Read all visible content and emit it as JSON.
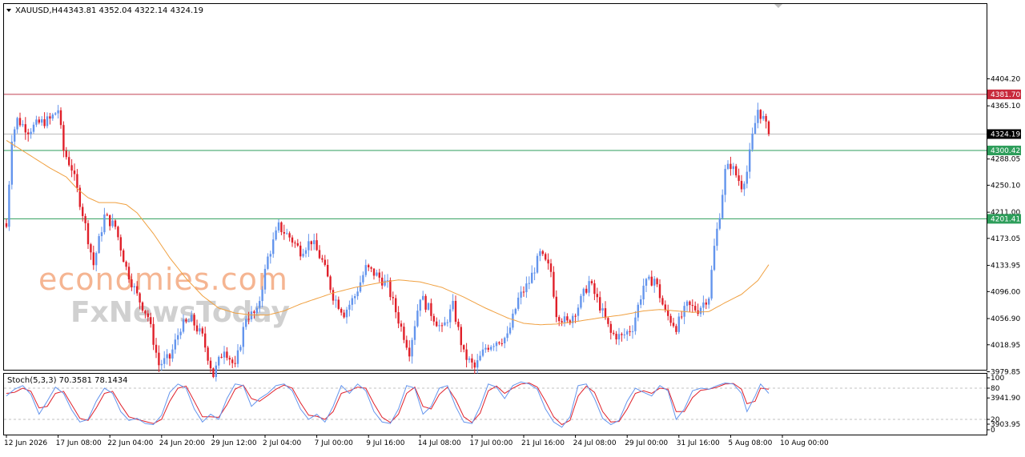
{
  "header": {
    "symbol": "XAUUSD,H4",
    "ohlc": "4343.81 4352.04 4322.14 4324.19"
  },
  "watermark": {
    "line1": "economies.com",
    "line2": "FxNewsToday"
  },
  "colors": {
    "bull": "#6495ed",
    "bear": "#e0202a",
    "ma": "#f0a040",
    "stoch_main": "#6495ed",
    "stoch_signal": "#e0202a",
    "resistance": "#c04050",
    "support": "#2e9e5b",
    "current": "#000000"
  },
  "chart_data": [
    {
      "type": "candlestick",
      "symbol": "XAUUSD",
      "timeframe": "H4",
      "ylim": [
        3890,
        4420
      ],
      "y_ticks": [
        4404.2,
        4365.1,
        4326.0,
        4288.05,
        4250.1,
        4211.0,
        4173.05,
        4133.95,
        4096.0,
        4056.9,
        4018.95,
        3979.85,
        3941.9,
        3903.95
      ],
      "x_tick_labels": [
        "12 Jun 2026",
        "17 Jun 08:00",
        "22 Jun 04:00",
        "24 Jun 20:00",
        "29 Jun 12:00",
        "2 Jul 04:00",
        "7 Jul 00:00",
        "9 Jul 16:00",
        "14 Jul 08:00",
        "17 Jul 00:00",
        "21 Jul 16:00",
        "24 Jul 08:00",
        "29 Jul 00:00",
        "31 Jul 16:00",
        "5 Aug 08:00",
        "10 Aug 00:00"
      ],
      "x_tick_index": [
        0,
        19,
        38,
        57,
        76,
        95,
        114,
        133,
        152,
        171,
        190,
        209,
        228,
        247,
        266,
        285
      ],
      "price_lines": [
        {
          "name": "resistance",
          "value": 4381.7,
          "label": "4381.70"
        },
        {
          "name": "current",
          "value": 4324.19,
          "label": "4324.19"
        },
        {
          "name": "support-1",
          "value": 4300.42,
          "label": "4300.42"
        },
        {
          "name": "support-2",
          "value": 4201.41,
          "label": "4201.41"
        }
      ],
      "anchors": [
        [
          0,
          4190
        ],
        [
          2,
          4320
        ],
        [
          4,
          4345
        ],
        [
          8,
          4330
        ],
        [
          12,
          4340
        ],
        [
          16,
          4345
        ],
        [
          19,
          4360
        ],
        [
          21,
          4300
        ],
        [
          24,
          4275
        ],
        [
          28,
          4210
        ],
        [
          32,
          4135
        ],
        [
          36,
          4205
        ],
        [
          40,
          4190
        ],
        [
          44,
          4130
        ],
        [
          48,
          4090
        ],
        [
          52,
          4060
        ],
        [
          56,
          3990
        ],
        [
          60,
          4000
        ],
        [
          64,
          4045
        ],
        [
          68,
          4055
        ],
        [
          72,
          4030
        ],
        [
          76,
          3975
        ],
        [
          80,
          4015
        ],
        [
          84,
          3985
        ],
        [
          88,
          4060
        ],
        [
          92,
          4065
        ],
        [
          96,
          4145
        ],
        [
          100,
          4190
        ],
        [
          104,
          4175
        ],
        [
          108,
          4155
        ],
        [
          112,
          4170
        ],
        [
          116,
          4140
        ],
        [
          120,
          4090
        ],
        [
          124,
          4065
        ],
        [
          128,
          4090
        ],
        [
          132,
          4130
        ],
        [
          136,
          4120
        ],
        [
          140,
          4105
        ],
        [
          144,
          4055
        ],
        [
          148,
          4010
        ],
        [
          152,
          4090
        ],
        [
          156,
          4065
        ],
        [
          160,
          4040
        ],
        [
          164,
          4075
        ],
        [
          168,
          4005
        ],
        [
          172,
          3985
        ],
        [
          176,
          4015
        ],
        [
          180,
          4025
        ],
        [
          184,
          4030
        ],
        [
          188,
          4085
        ],
        [
          192,
          4110
        ],
        [
          196,
          4150
        ],
        [
          200,
          4125
        ],
        [
          202,
          4065
        ],
        [
          206,
          4050
        ],
        [
          210,
          4075
        ],
        [
          214,
          4110
        ],
        [
          218,
          4075
        ],
        [
          222,
          4035
        ],
        [
          226,
          4030
        ],
        [
          230,
          4045
        ],
        [
          234,
          4105
        ],
        [
          238,
          4115
        ],
        [
          242,
          4065
        ],
        [
          246,
          4045
        ],
        [
          250,
          4075
        ],
        [
          254,
          4070
        ],
        [
          258,
          4090
        ],
        [
          260,
          4160
        ],
        [
          262,
          4210
        ],
        [
          264,
          4270
        ],
        [
          266,
          4280
        ],
        [
          270,
          4250
        ],
        [
          272,
          4270
        ],
        [
          274,
          4320
        ],
        [
          276,
          4360
        ],
        [
          278,
          4346
        ],
        [
          280,
          4324
        ]
      ],
      "last_close": 4324.19,
      "moving_average": {
        "anchors": [
          [
            0,
            4315
          ],
          [
            8,
            4295
          ],
          [
            16,
            4275
          ],
          [
            22,
            4262
          ],
          [
            26,
            4245
          ],
          [
            30,
            4232
          ],
          [
            34,
            4225
          ],
          [
            40,
            4225
          ],
          [
            44,
            4222
          ],
          [
            48,
            4210
          ],
          [
            54,
            4180
          ],
          [
            60,
            4145
          ],
          [
            66,
            4115
          ],
          [
            72,
            4090
          ],
          [
            78,
            4072
          ],
          [
            84,
            4065
          ],
          [
            90,
            4062
          ],
          [
            96,
            4062
          ],
          [
            102,
            4068
          ],
          [
            108,
            4078
          ],
          [
            114,
            4086
          ],
          [
            120,
            4094
          ],
          [
            128,
            4102
          ],
          [
            136,
            4108
          ],
          [
            144,
            4113
          ],
          [
            152,
            4110
          ],
          [
            160,
            4102
          ],
          [
            168,
            4088
          ],
          [
            176,
            4072
          ],
          [
            184,
            4058
          ],
          [
            190,
            4050
          ],
          [
            196,
            4048
          ],
          [
            202,
            4049
          ],
          [
            210,
            4053
          ],
          [
            218,
            4058
          ],
          [
            226,
            4062
          ],
          [
            234,
            4068
          ],
          [
            240,
            4070
          ],
          [
            246,
            4068
          ],
          [
            252,
            4066
          ],
          [
            258,
            4067
          ],
          [
            264,
            4080
          ],
          [
            270,
            4092
          ],
          [
            276,
            4112
          ],
          [
            280,
            4135
          ]
        ]
      }
    },
    {
      "type": "line",
      "name": "Stoch(5,3,3)",
      "label": "Stoch(5,3,3) 70.3581 78.1434",
      "ylim": [
        0,
        100
      ],
      "levels": [
        20,
        80
      ],
      "y_ticks": [
        100,
        80,
        20,
        0
      ],
      "main_anchors": [
        [
          0,
          65
        ],
        [
          3,
          78
        ],
        [
          6,
          85
        ],
        [
          9,
          68
        ],
        [
          12,
          30
        ],
        [
          15,
          55
        ],
        [
          18,
          82
        ],
        [
          21,
          70
        ],
        [
          24,
          38
        ],
        [
          27,
          15
        ],
        [
          30,
          20
        ],
        [
          33,
          55
        ],
        [
          36,
          80
        ],
        [
          39,
          70
        ],
        [
          42,
          35
        ],
        [
          45,
          18
        ],
        [
          48,
          22
        ],
        [
          51,
          12
        ],
        [
          54,
          10
        ],
        [
          57,
          28
        ],
        [
          60,
          72
        ],
        [
          63,
          88
        ],
        [
          66,
          80
        ],
        [
          69,
          40
        ],
        [
          72,
          15
        ],
        [
          75,
          30
        ],
        [
          78,
          20
        ],
        [
          81,
          60
        ],
        [
          84,
          88
        ],
        [
          87,
          85
        ],
        [
          90,
          45
        ],
        [
          93,
          60
        ],
        [
          96,
          70
        ],
        [
          99,
          85
        ],
        [
          102,
          88
        ],
        [
          105,
          75
        ],
        [
          108,
          40
        ],
        [
          111,
          20
        ],
        [
          114,
          30
        ],
        [
          117,
          15
        ],
        [
          120,
          45
        ],
        [
          123,
          85
        ],
        [
          126,
          70
        ],
        [
          129,
          88
        ],
        [
          132,
          75
        ],
        [
          135,
          35
        ],
        [
          138,
          15
        ],
        [
          141,
          12
        ],
        [
          144,
          40
        ],
        [
          147,
          85
        ],
        [
          150,
          80
        ],
        [
          153,
          30
        ],
        [
          156,
          45
        ],
        [
          159,
          80
        ],
        [
          162,
          85
        ],
        [
          165,
          45
        ],
        [
          168,
          15
        ],
        [
          171,
          12
        ],
        [
          174,
          45
        ],
        [
          177,
          88
        ],
        [
          180,
          82
        ],
        [
          183,
          60
        ],
        [
          186,
          85
        ],
        [
          189,
          92
        ],
        [
          192,
          88
        ],
        [
          195,
          78
        ],
        [
          198,
          40
        ],
        [
          201,
          15
        ],
        [
          204,
          5
        ],
        [
          207,
          25
        ],
        [
          210,
          85
        ],
        [
          213,
          88
        ],
        [
          216,
          60
        ],
        [
          219,
          22
        ],
        [
          222,
          10
        ],
        [
          225,
          18
        ],
        [
          228,
          55
        ],
        [
          231,
          80
        ],
        [
          234,
          72
        ],
        [
          237,
          65
        ],
        [
          240,
          85
        ],
        [
          243,
          75
        ],
        [
          246,
          20
        ],
        [
          249,
          40
        ],
        [
          252,
          75
        ],
        [
          255,
          80
        ],
        [
          258,
          78
        ],
        [
          261,
          85
        ],
        [
          264,
          90
        ],
        [
          267,
          88
        ],
        [
          270,
          70
        ],
        [
          272,
          35
        ],
        [
          275,
          65
        ],
        [
          277,
          88
        ],
        [
          280,
          70
        ]
      ],
      "signal_anchors": [
        [
          0,
          70
        ],
        [
          3,
          72
        ],
        [
          6,
          80
        ],
        [
          9,
          74
        ],
        [
          12,
          42
        ],
        [
          15,
          45
        ],
        [
          18,
          70
        ],
        [
          21,
          74
        ],
        [
          24,
          48
        ],
        [
          27,
          22
        ],
        [
          30,
          18
        ],
        [
          33,
          42
        ],
        [
          36,
          70
        ],
        [
          39,
          74
        ],
        [
          42,
          48
        ],
        [
          45,
          25
        ],
        [
          48,
          20
        ],
        [
          51,
          16
        ],
        [
          54,
          12
        ],
        [
          57,
          20
        ],
        [
          60,
          55
        ],
        [
          63,
          80
        ],
        [
          66,
          84
        ],
        [
          69,
          55
        ],
        [
          72,
          25
        ],
        [
          75,
          25
        ],
        [
          78,
          24
        ],
        [
          81,
          48
        ],
        [
          84,
          78
        ],
        [
          87,
          86
        ],
        [
          90,
          60
        ],
        [
          93,
          55
        ],
        [
          96,
          66
        ],
        [
          99,
          78
        ],
        [
          102,
          86
        ],
        [
          105,
          80
        ],
        [
          108,
          52
        ],
        [
          111,
          28
        ],
        [
          114,
          26
        ],
        [
          117,
          20
        ],
        [
          120,
          35
        ],
        [
          123,
          70
        ],
        [
          126,
          75
        ],
        [
          129,
          82
        ],
        [
          132,
          80
        ],
        [
          135,
          50
        ],
        [
          138,
          24
        ],
        [
          141,
          14
        ],
        [
          144,
          30
        ],
        [
          147,
          70
        ],
        [
          150,
          82
        ],
        [
          153,
          45
        ],
        [
          156,
          40
        ],
        [
          159,
          68
        ],
        [
          162,
          82
        ],
        [
          165,
          58
        ],
        [
          168,
          25
        ],
        [
          171,
          14
        ],
        [
          174,
          32
        ],
        [
          177,
          75
        ],
        [
          180,
          84
        ],
        [
          183,
          70
        ],
        [
          186,
          80
        ],
        [
          189,
          88
        ],
        [
          192,
          90
        ],
        [
          195,
          82
        ],
        [
          198,
          55
        ],
        [
          201,
          25
        ],
        [
          204,
          10
        ],
        [
          207,
          18
        ],
        [
          210,
          65
        ],
        [
          213,
          84
        ],
        [
          216,
          72
        ],
        [
          219,
          35
        ],
        [
          222,
          15
        ],
        [
          225,
          16
        ],
        [
          228,
          40
        ],
        [
          231,
          70
        ],
        [
          234,
          75
        ],
        [
          237,
          70
        ],
        [
          240,
          80
        ],
        [
          243,
          78
        ],
        [
          246,
          35
        ],
        [
          249,
          35
        ],
        [
          252,
          62
        ],
        [
          255,
          76
        ],
        [
          258,
          78
        ],
        [
          261,
          82
        ],
        [
          264,
          88
        ],
        [
          267,
          89
        ],
        [
          270,
          78
        ],
        [
          272,
          50
        ],
        [
          275,
          55
        ],
        [
          277,
          80
        ],
        [
          280,
          78
        ]
      ]
    }
  ]
}
